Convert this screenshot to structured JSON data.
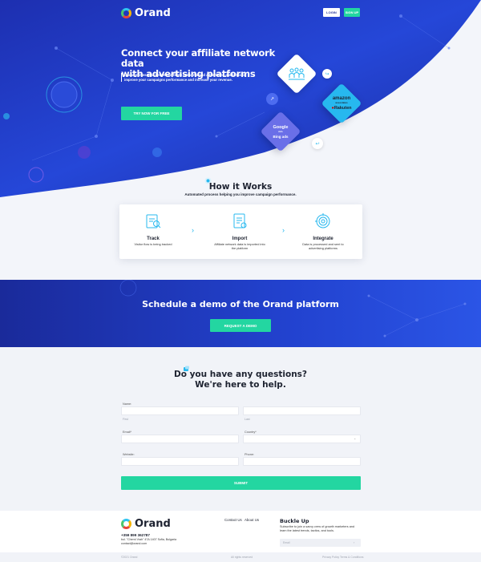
{
  "header": {
    "logo_text": "Orand",
    "login_label": "LOGIN",
    "signup_label": "SIGN UP"
  },
  "hero": {
    "title_line1": "Connect your affiliate network data",
    "title_line2": "with advertising platforms",
    "subtitle_line1": "Orand moves data between affiliate networks and advertising platforms to",
    "subtitle_line2": "improve your campaigns performance and increase your revenue.",
    "cta_label": "TRY NOW FOR FREE",
    "partners": {
      "amazon": "amazon",
      "amazon_sub": "associates",
      "rakuten": "Rakuten",
      "google": "Google",
      "google_sub": "Ads",
      "bing": "Bing ads"
    }
  },
  "how_it_works": {
    "title": "How it Works",
    "subtitle": "Automated process helping you improve campaign performance.",
    "steps": [
      {
        "title": "Track",
        "desc_line1": "Visitor flow is being tracked",
        "desc_line2": "",
        "icon": "track-icon"
      },
      {
        "title": "Import",
        "desc_line1": "Affiliate network data is imported into",
        "desc_line2": "the platform",
        "icon": "import-icon"
      },
      {
        "title": "Integrate",
        "desc_line1": "Data is processed and sent to",
        "desc_line2": "advertising platforms",
        "icon": "integrate-icon"
      }
    ]
  },
  "schedule": {
    "title": "Schedule a demo of the Orand platform",
    "cta_label": "REQUEST A DEMO"
  },
  "contact": {
    "title_line1": "Do you have any questions?",
    "title_line2": "We're here to help.",
    "fields": {
      "name_label": "Name:",
      "first_hint": "First",
      "last_hint": "Last",
      "email_label": "Email*",
      "country_label": "Country*",
      "website_label": "Website:",
      "phone_label": "Phone:"
    },
    "submit_label": "SUBMIT"
  },
  "footer": {
    "logo_text": "Orand",
    "phone": "+359 899 362787",
    "address_line1": "bul. \"Cherni Vrah\" 47A 1407 Sofia, Bulgaria",
    "address_line2": "contact@orand.com",
    "link_contact": "Contact Us",
    "link_about": "About Us",
    "buckle_title": "Buckle Up",
    "buckle_text": "Subscribe to join a savvy crew of growth marketers and learn the latest trends, tactics, and tools.",
    "email_placeholder": "Email",
    "copyright": "©2021 Orand",
    "rights": "All rights reserved",
    "privacy": "Privacy Policy",
    "terms": "Terms & Conditions"
  },
  "colors": {
    "hero_blue": "#2347d6",
    "hero_dark": "#1a2a9a",
    "accent_green": "#23d6a1",
    "accent_cyan": "#27b8ef"
  }
}
